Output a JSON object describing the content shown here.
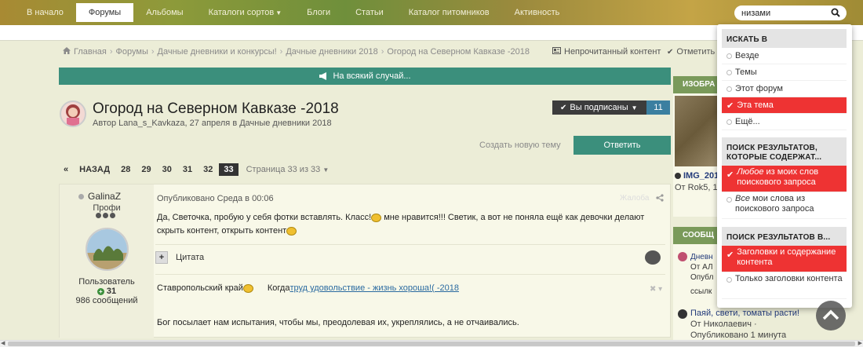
{
  "nav": {
    "items": [
      {
        "label": "В начало",
        "active": false
      },
      {
        "label": "Форумы",
        "active": true
      },
      {
        "label": "Альбомы",
        "active": false
      },
      {
        "label": "Каталоги сортов",
        "active": false,
        "dropdown": true
      },
      {
        "label": "Блоги",
        "active": false
      },
      {
        "label": "Статьи",
        "active": false
      },
      {
        "label": "Каталог питомников",
        "active": false
      },
      {
        "label": "Активность",
        "active": false
      }
    ]
  },
  "search": {
    "value": "низами"
  },
  "breadcrumb": {
    "home": "Главная",
    "forums": "Форумы",
    "diaries": "Дачные дневники и конкурсы!",
    "diaries2018": "Дачные дневники 2018",
    "current": "Огород на Северном Кавказе -2018"
  },
  "toolbar": {
    "unread": "Непрочитанный контент",
    "mark": "Отметить"
  },
  "announcement": {
    "text": "На всякий случай..."
  },
  "topic": {
    "title": "Огород на Северном Кавказе -2018",
    "author_line": "Автор Lana_s_Kavkaza, 27 апреля в Дачные дневники 2018",
    "subscribed_label": "Вы подписаны",
    "subscribed_count": "11",
    "new_topic": "Создать новую тему",
    "reply": "Ответить"
  },
  "pager": {
    "back": "НАЗАД",
    "pages": [
      "28",
      "29",
      "30",
      "31",
      "32",
      "33"
    ],
    "current": "33",
    "info": "Страница 33 из 33"
  },
  "post": {
    "username": "GalinaZ",
    "rank": "Профи",
    "group": "Пользователь",
    "reputation": "31",
    "post_count": "986 сообщений",
    "date": "Опубликовано Среда в 00:06",
    "report": "Жалоба",
    "text1": "Да, Светочка, пробую у себя фотки вставлять. Класс!",
    "text2": " мне нравится!!! Светик, а вот не поняла ещё как девочки делают скрыть контент, открыть контент",
    "quote": "Цитата",
    "sig_region": "Ставропольский край",
    "sig_when": "Когда",
    "sig_link": " труд удовольствие - жизнь хороша!( -2018 ",
    "sig_text": "Бог посылает нам испытания, чтобы мы, преодолевая их, укреплялись, а не отчаивались."
  },
  "sidebar": {
    "images_head": "ИЗОБРА",
    "image_name": "IMG_201",
    "image_from": "От Rok5, 1",
    "messages_head": "СООБЩ",
    "msg1_title": "Дневн",
    "msg1_from": "От АЛ",
    "msg1_pub": "Опубл",
    "msg1_link": "ссылк",
    "msg2_title": "Паяй, свети, томаты расти!",
    "msg2_from": "От Николаевич ·",
    "msg2_pub": "Опубликовано 1 минута"
  },
  "search_dropdown": {
    "scope_head": "ИСКАТЬ В",
    "scope_options": [
      "Везде",
      "Темы",
      "Этот форум",
      "Эта тема",
      "Ещё..."
    ],
    "scope_selected": "Эта тема",
    "match_head": "ПОИСК РЕЗУЛЬТАТОВ, КОТОРЫЕ СОДЕРЖАТ...",
    "match_any_em": "Любое",
    "match_any_rest": " из моих слов поискового запроса",
    "match_all_em": "Все",
    "match_all_rest": " мои слова из поискового запроса",
    "match_selected": "any",
    "in_head": "ПОИСК РЕЗУЛЬТАТОВ В...",
    "in_options": [
      "Заголовки и содержание контента",
      "Только заголовки контента"
    ],
    "in_selected": "Заголовки и содержание контента"
  },
  "colors": {
    "accent": "#3b8f7c",
    "selected": "#ee3333",
    "dark": "#3c3c3c"
  }
}
